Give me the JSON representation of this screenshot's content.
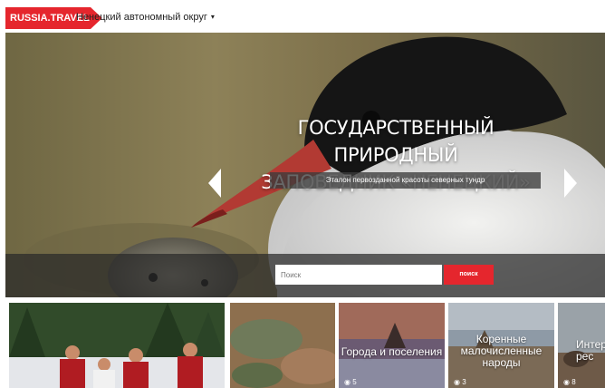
{
  "header": {
    "logo": "RUSSIA.TRAVEL",
    "region": "Ненецкий автономный округ",
    "region_caret": "▾"
  },
  "hero": {
    "title_line1": "ГОСУДАРСТВЕННЫЙ ПРИРОДНЫЙ",
    "title_line2": "ЗАПОВЕДНИК «НЕНЕЦКИЙ»",
    "subtitle": "Эталон первозданной красоты северных тундр",
    "search_placeholder": "Поиск",
    "search_button": "поиск"
  },
  "tiles": [
    {
      "label": "",
      "count": ""
    },
    {
      "label": "",
      "count": ""
    },
    {
      "label": "Города и поселения",
      "count": "5"
    },
    {
      "label": "Коренные малочисленные народы",
      "count": "3"
    },
    {
      "label": "Интер рес",
      "count": "8"
    }
  ],
  "colors": {
    "accent": "#e5262d"
  }
}
